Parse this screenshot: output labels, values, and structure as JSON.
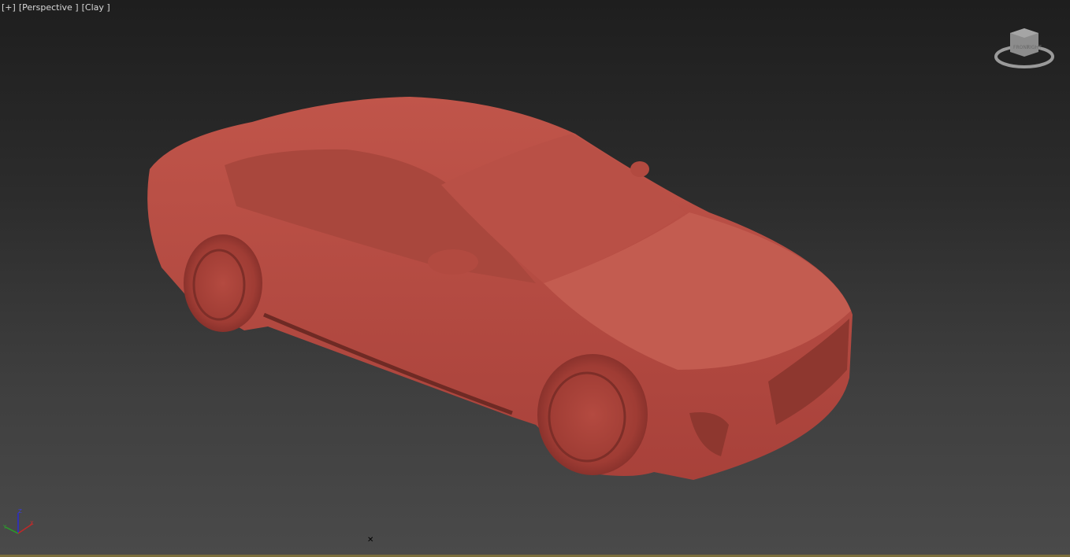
{
  "viewport": {
    "labels": {
      "plus": "[+]",
      "view": "[Perspective ]",
      "shading": "[Clay ]"
    },
    "viewcube_faces": {
      "front": "FRONT",
      "right": "RIGHT"
    },
    "axes": {
      "z": "Z",
      "x": "X",
      "y": "Y"
    },
    "colors": {
      "clay": "#b84b40",
      "background_top": "#1e1e1e",
      "background_bottom": "#4a4a4a"
    }
  }
}
